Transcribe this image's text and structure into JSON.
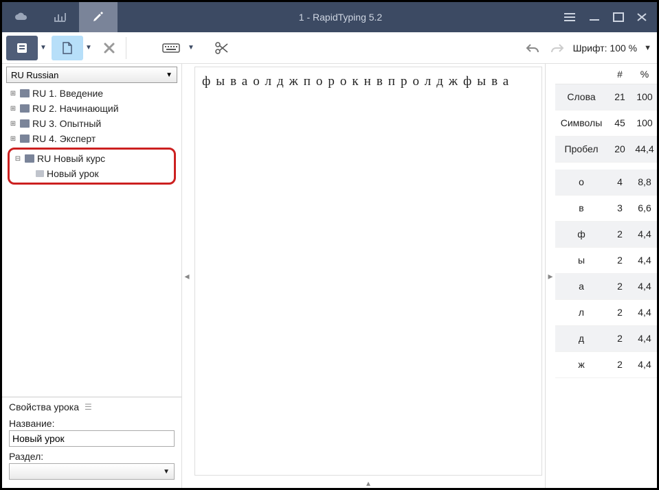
{
  "titlebar": {
    "title": "1 - RapidTyping 5.2"
  },
  "toolbar": {
    "font_label": "Шрифт: 100 %"
  },
  "left": {
    "lang_select": "RU Russian",
    "tree": [
      {
        "label": "RU 1. Введение",
        "exp": "+"
      },
      {
        "label": "RU 2. Начинающий",
        "exp": "+"
      },
      {
        "label": "RU 3. Опытный",
        "exp": "+"
      },
      {
        "label": "RU 4. Эксперт",
        "exp": "+"
      }
    ],
    "tree_new_course": "RU Новый курс",
    "tree_new_lesson": "Новый урок",
    "props": {
      "title": "Свойства урока",
      "name_label": "Название:",
      "name_value": "Новый урок",
      "section_label": "Раздел:",
      "section_value": ""
    }
  },
  "center": {
    "text": "фываолджпорокнвпролджфыва"
  },
  "right": {
    "head_n": "#",
    "head_p": "%",
    "rows": [
      {
        "name": "Слова",
        "n": "21",
        "p": "100",
        "alt": true
      },
      {
        "name": "Символы",
        "n": "45",
        "p": "100",
        "alt": false
      },
      {
        "name": "Пробел",
        "n": "20",
        "p": "44,4",
        "alt": true
      },
      {
        "name": "о",
        "n": "4",
        "p": "8,8",
        "alt": true
      },
      {
        "name": "в",
        "n": "3",
        "p": "6,6",
        "alt": false
      },
      {
        "name": "ф",
        "n": "2",
        "p": "4,4",
        "alt": true
      },
      {
        "name": "ы",
        "n": "2",
        "p": "4,4",
        "alt": false
      },
      {
        "name": "а",
        "n": "2",
        "p": "4,4",
        "alt": true
      },
      {
        "name": "л",
        "n": "2",
        "p": "4,4",
        "alt": false
      },
      {
        "name": "д",
        "n": "2",
        "p": "4,4",
        "alt": true
      },
      {
        "name": "ж",
        "n": "2",
        "p": "4,4",
        "alt": false
      }
    ]
  }
}
